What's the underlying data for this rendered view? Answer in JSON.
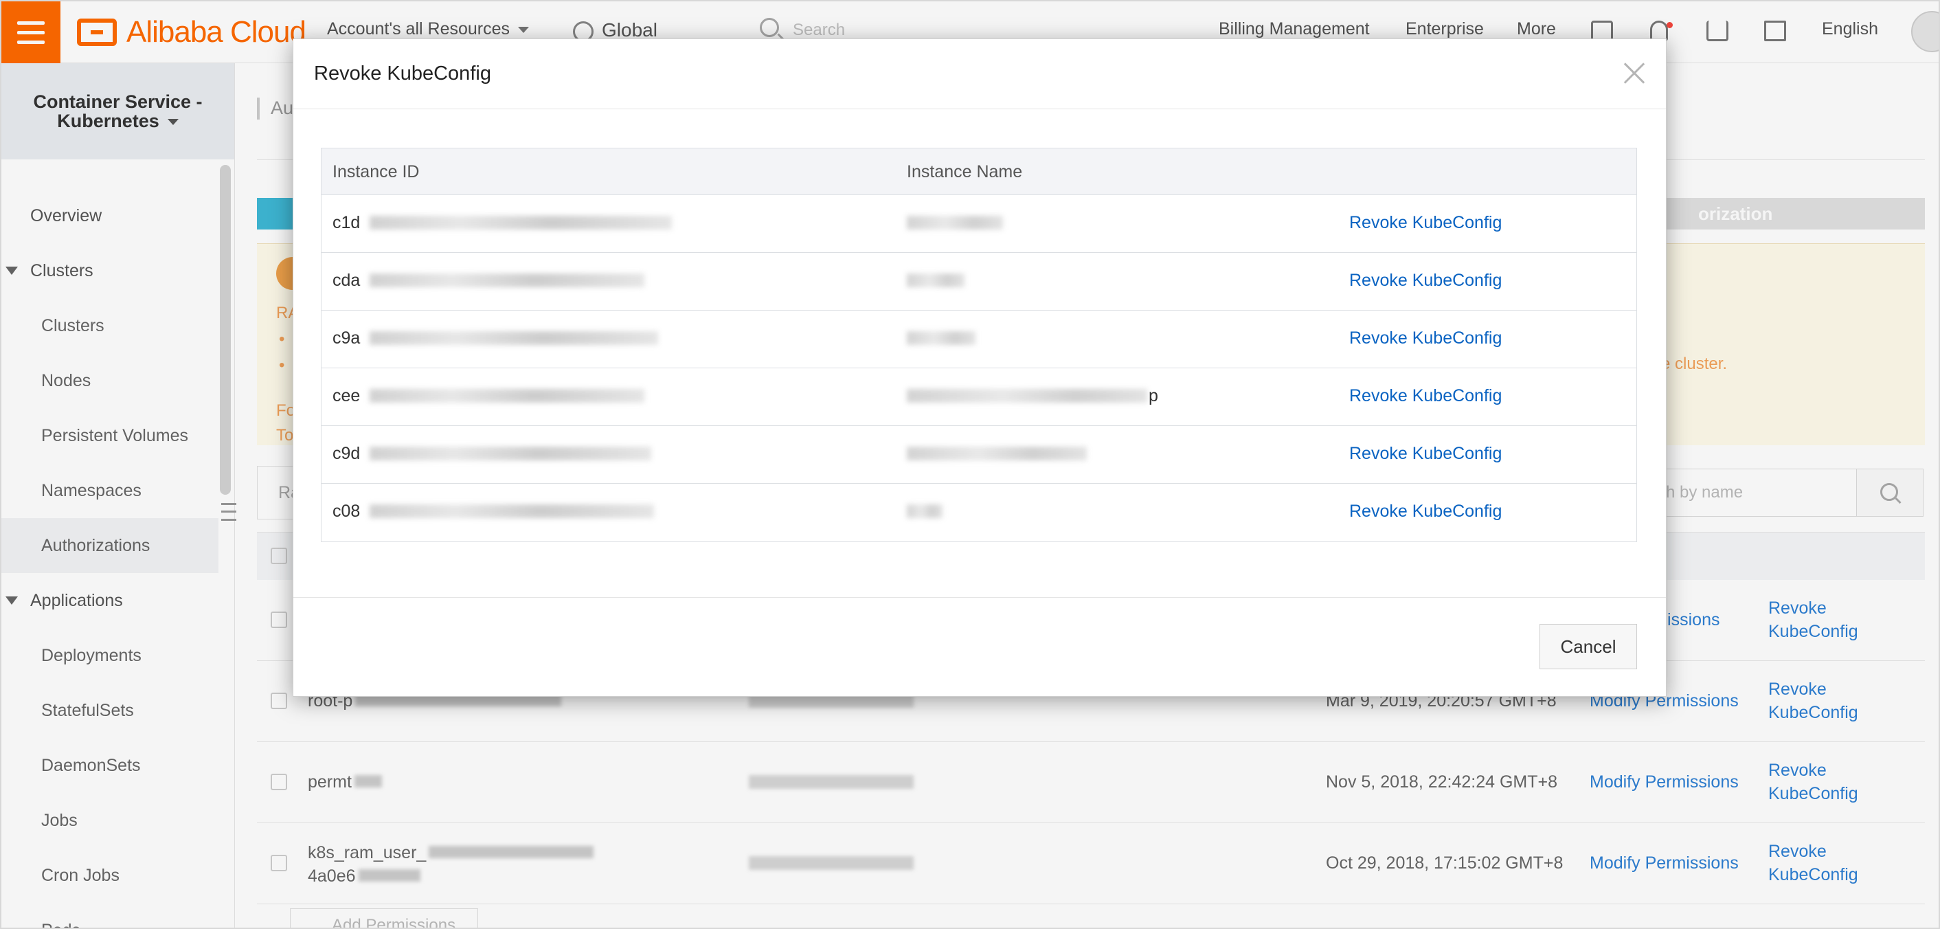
{
  "topbar": {
    "logo_text": "Alibaba Cloud",
    "resources": "Account's all Resources",
    "region": "Global",
    "search_placeholder": "Search",
    "billing": "Billing Management",
    "enterprise": "Enterprise",
    "more": "More",
    "language": "English"
  },
  "sidebar": {
    "title_line1": "Container Service -",
    "title_line2": "Kubernetes",
    "items": [
      {
        "label": "Overview",
        "level": 1
      },
      {
        "label": "Clusters",
        "level": 1,
        "expandable": true
      },
      {
        "label": "Clusters",
        "level": 2
      },
      {
        "label": "Nodes",
        "level": 2
      },
      {
        "label": "Persistent Volumes",
        "level": 2
      },
      {
        "label": "Namespaces",
        "level": 2
      },
      {
        "label": "Authorizations",
        "level": 2,
        "active": true
      },
      {
        "label": "Applications",
        "level": 1,
        "expandable": true
      },
      {
        "label": "Deployments",
        "level": 2
      },
      {
        "label": "StatefulSets",
        "level": 2
      },
      {
        "label": "DaemonSets",
        "level": 2
      },
      {
        "label": "Jobs",
        "level": 2
      },
      {
        "label": "Cron Jobs",
        "level": 2
      },
      {
        "label": "Pods",
        "level": 2
      }
    ]
  },
  "background": {
    "page_title_frag": "Au",
    "auth_tab_frag": "orization",
    "notice_frag_ra": "RA",
    "notice_frag_fo": "Fo",
    "notice_frag_to": "To",
    "notice_frag_cluster": "e cluster.",
    "row_filter_frag": "Ra",
    "search_placeholder_frag": "rch by name",
    "add_permissions": "Add Permissions",
    "rows": [
      {
        "user_line1": "root-p",
        "user_line2": "",
        "date": "Mar 9, 2019, 20:20:57 GMT+8",
        "modify": "Modify Permissions",
        "revoke": "Revoke KubeConfig"
      },
      {
        "user_line1": "permt",
        "user_line2": "",
        "date": "Nov 5, 2018, 22:42:24 GMT+8",
        "modify": "Modify Permissions",
        "revoke": "Revoke KubeConfig"
      },
      {
        "user_line1": "k8s_ram_user_",
        "user_line2": "4a0e6",
        "date": "Oct 29, 2018, 17:15:02 GMT+8",
        "modify": "Modify Permissions",
        "revoke": "Revoke KubeConfig"
      }
    ],
    "partial_row": {
      "modify": "ermissions",
      "revoke": "Revoke KubeConfig"
    }
  },
  "modal": {
    "title": "Revoke KubeConfig",
    "col_instance_id": "Instance ID",
    "col_instance_name": "Instance Name",
    "rows": [
      {
        "id_prefix": "c1d",
        "name_tail": "",
        "action": "Revoke KubeConfig"
      },
      {
        "id_prefix": "cda",
        "name_tail": "",
        "action": "Revoke KubeConfig"
      },
      {
        "id_prefix": "c9a",
        "name_tail": "",
        "action": "Revoke KubeConfig"
      },
      {
        "id_prefix": "cee",
        "name_tail": "p",
        "action": "Revoke KubeConfig"
      },
      {
        "id_prefix": "c9d",
        "name_tail": "",
        "action": "Revoke KubeConfig"
      },
      {
        "id_prefix": "c08",
        "name_tail": "",
        "action": "Revoke KubeConfig"
      }
    ],
    "cancel": "Cancel"
  }
}
